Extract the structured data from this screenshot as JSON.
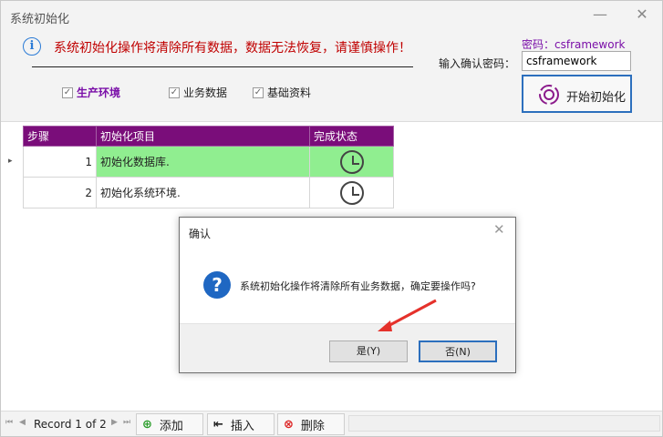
{
  "window": {
    "title": "系统初始化",
    "minimize": "—",
    "close": "✕"
  },
  "warning": "系统初始化操作将清除所有数据，数据无法恢复，请谨慎操作！",
  "password": {
    "hint": "密码：csframework",
    "label": "输入确认密码：",
    "value": "csframework"
  },
  "start_button": {
    "label": "开始初始化"
  },
  "options": [
    {
      "label": "生产环境",
      "checked": true,
      "emphasized": true
    },
    {
      "label": "业务数据",
      "checked": true,
      "emphasized": false
    },
    {
      "label": "基础资料",
      "checked": true,
      "emphasized": false
    }
  ],
  "grid": {
    "columns": [
      "步骤",
      "初始化项目",
      "完成状态"
    ],
    "rows": [
      {
        "step": "1",
        "item": "初始化数据库.",
        "status": "clock-icon"
      },
      {
        "step": "2",
        "item": "初始化系统环境.",
        "status": "clock-icon"
      }
    ]
  },
  "navigator": {
    "record_text": "Record 1 of 2",
    "add": "添加",
    "insert": "插入",
    "delete": "删除"
  },
  "dialog": {
    "title": "确认",
    "message": "系统初始化操作将清除所有业务数据，确定要操作吗?",
    "yes": "是(Y)",
    "no": "否(N)"
  },
  "colors": {
    "accent": "#7a0d7a",
    "warning": "#c00000",
    "highlight_row": "#90ee90",
    "focus_border": "#2c6fbd"
  }
}
